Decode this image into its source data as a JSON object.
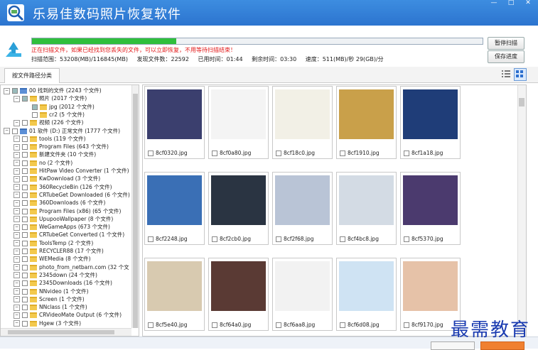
{
  "app": {
    "title": "乐易佳数码照片恢复软件"
  },
  "scan": {
    "progress_percent": 32,
    "warning": "正在扫描文件，如果已经找到您丢失的文件，可以立即恢复，不用等待扫描结束！",
    "range": "扫描范围：53208(MB)/116845(MB)",
    "found": "发现文件数：22592",
    "elapsed": "已用时间：01:44",
    "remaining": "剩余时间：03:30",
    "speed": "速度：511(MB)/秒  29(GB)/分",
    "pause_label": "暂停扫描",
    "save_label": "保存进度"
  },
  "tabs": {
    "by_path": "按文件路径分类"
  },
  "tree": {
    "rows": [
      {
        "label": "00 找到的文件 (2243 个文件)",
        "level": 0
      },
      {
        "label": "照片   (2017 个文件)",
        "level": 1
      },
      {
        "label": "jpg   (2012 个文件)",
        "level": 2
      },
      {
        "label": "cr2   (5 个文件)",
        "level": 2
      },
      {
        "label": "视频   (226 个文件)",
        "level": 1
      },
      {
        "label": "01 软件 (D:) 正常文件 (1777 个文件)",
        "level": 0
      },
      {
        "label": "tools   (119 个文件)",
        "level": 1
      },
      {
        "label": "Program Files   (643 个文件)",
        "level": 1
      },
      {
        "label": "新建文件夹   (10 个文件)",
        "level": 1
      },
      {
        "label": "no   (2 个文件)",
        "level": 1
      },
      {
        "label": "HitPaw Video Converter   (1 个文件)",
        "level": 1
      },
      {
        "label": "KwDownload   (3 个文件)",
        "level": 1
      },
      {
        "label": "360RecycleBin   (126 个文件)",
        "level": 1
      },
      {
        "label": "CRTubeGet Downloaded   (6 个文件)",
        "level": 1
      },
      {
        "label": "360Downloads   (6 个文件)",
        "level": 1
      },
      {
        "label": "Program Files (x86)   (65 个文件)",
        "level": 1
      },
      {
        "label": "UpupooWallpaper   (8 个文件)",
        "level": 1
      },
      {
        "label": "WeGameApps   (673 个文件)",
        "level": 1
      },
      {
        "label": "CRTubeGet Converted   (1 个文件)",
        "level": 1
      },
      {
        "label": "ToolsTemp   (2 个文件)",
        "level": 1
      },
      {
        "label": "RECYCLER88   (17 个文件)",
        "level": 1
      },
      {
        "label": "WEMedia   (8 个文件)",
        "level": 1
      },
      {
        "label": "photo_from_netbarn.com   (32 个文",
        "level": 1
      },
      {
        "label": "2345down   (24 个文件)",
        "level": 1
      },
      {
        "label": "2345Downloads   (16 个文件)",
        "level": 1
      },
      {
        "label": "NNvideo   (1 个文件)",
        "level": 1
      },
      {
        "label": "Screen   (1 个文件)",
        "level": 1
      },
      {
        "label": "NNclass   (1 个文件)",
        "level": 1
      },
      {
        "label": "CRVideoMate Output   (6 个文件)",
        "level": 1
      },
      {
        "label": "Hgew   (3 个文件)",
        "level": 1
      }
    ]
  },
  "thumbnails": [
    {
      "name": "8cf0320.jpg",
      "color": "#3b3f6e"
    },
    {
      "name": "8cf0a80.jpg",
      "color": "#f4f4f4"
    },
    {
      "name": "8cf18c0.jpg",
      "color": "#f2f0e6"
    },
    {
      "name": "8cf1910.jpg",
      "color": "#c9a04a"
    },
    {
      "name": "8cf1a18.jpg",
      "color": "#1f3d78"
    },
    {
      "name": "8cf2248.jpg",
      "color": "#3a6fb5"
    },
    {
      "name": "8cf2cb0.jpg",
      "color": "#2a3442"
    },
    {
      "name": "8cf2f68.jpg",
      "color": "#b9c4d6"
    },
    {
      "name": "8cf4bc8.jpg",
      "color": "#d3dbe4"
    },
    {
      "name": "8cf5370.jpg",
      "color": "#4b3a6e"
    },
    {
      "name": "8cf5e40.jpg",
      "color": "#d8cab0"
    },
    {
      "name": "8cf64a0.jpg",
      "color": "#5a3a34"
    },
    {
      "name": "8cf6aa8.jpg",
      "color": "#f2f2f2"
    },
    {
      "name": "8cf6d08.jpg",
      "color": "#cfe3f3"
    },
    {
      "name": "8cf9170.jpg",
      "color": "#e6c2a8"
    }
  ],
  "watermark": "最需教育",
  "colors": {
    "titlebar": "#2c74cf",
    "progress": "#2fbf3c",
    "warning": "#e21818"
  }
}
